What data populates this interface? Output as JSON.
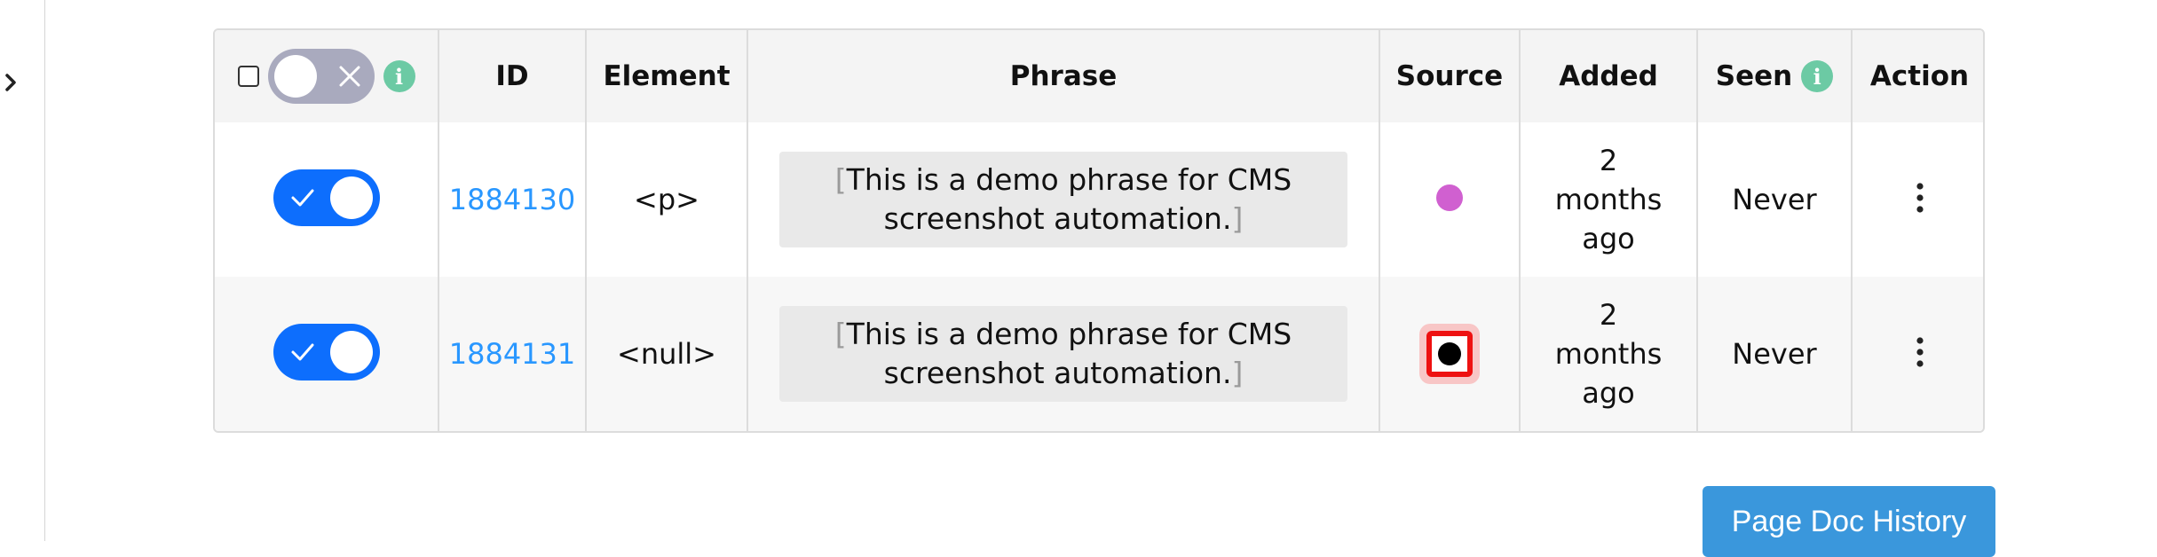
{
  "table": {
    "headers": {
      "id": "ID",
      "element": "Element",
      "phrase": "Phrase",
      "source": "Source",
      "added": "Added",
      "seen": "Seen",
      "action": "Action"
    },
    "info_glyph": "i",
    "rows": [
      {
        "enabled": true,
        "id": "1884130",
        "element": "<p>",
        "phrase": "This is a demo phrase for CMS screenshot automation.",
        "source_color": "#d060d0",
        "added": "2 months ago",
        "seen": "Never"
      },
      {
        "enabled": true,
        "id": "1884131",
        "element": "<null>",
        "phrase": "This is a demo phrase for CMS screenshot automation.",
        "source_color": "#000000",
        "added": "2 months ago",
        "seen": "Never"
      }
    ]
  },
  "footer": {
    "doc_history_label": "Page Doc History"
  },
  "colors": {
    "accent": "#0d6efd",
    "link": "#2997ff",
    "info": "#6ccaa4",
    "button": "#3a97dc",
    "highlight_border": "#ee1111"
  },
  "icons": [
    "chevron-right-icon",
    "info-icon",
    "check-icon",
    "close-icon",
    "kebab-menu-icon"
  ]
}
